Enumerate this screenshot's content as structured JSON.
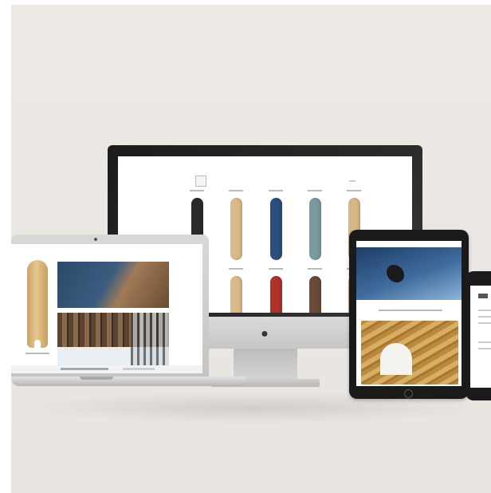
{
  "scene": {
    "description_tag": "responsive-devices-mockup",
    "background_color": "#eae6e2"
  },
  "imac": {
    "boards": [
      {
        "color": "#2a2a2a"
      },
      {
        "color": "#d8b987"
      },
      {
        "color": "#2a4f7c"
      },
      {
        "color": "#7a9aa0"
      },
      {
        "color": "#d6b684"
      },
      {
        "color": "#d9b98a"
      },
      {
        "color": "#b0312c"
      },
      {
        "color": "#6b4a37"
      },
      {
        "color": "#d6b684"
      }
    ]
  },
  "laptop": {
    "photo_caption": ""
  },
  "colors": {
    "wood": "#c9a46a",
    "navy": "#2a4f7c",
    "frame_dark": "#1a1a1a",
    "aluminium": "#c4c4c4"
  }
}
